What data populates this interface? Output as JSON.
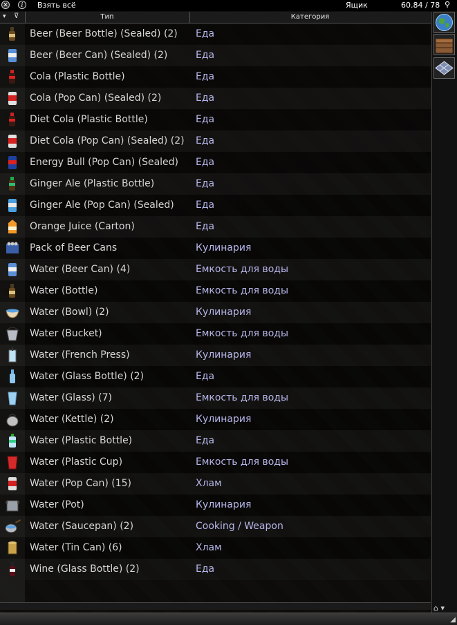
{
  "titlebar": {
    "take_all": "Взять всё",
    "container": "Ящик",
    "weight": "60.84 / 78",
    "info": "i",
    "close": "✕",
    "pin": "⚲"
  },
  "columns": {
    "type": "Тип",
    "category": "Категория",
    "sort": "▾",
    "filter": "⊽"
  },
  "rows": [
    {
      "name": "Beer (Beer Bottle) (Sealed) (2)",
      "category": "Еда",
      "icon": "beer-bottle-icon"
    },
    {
      "name": "Beer (Beer Can) (Sealed) (2)",
      "category": "Еда",
      "icon": "beer-can-icon"
    },
    {
      "name": "Cola (Plastic Bottle)",
      "category": "Еда",
      "icon": "cola-bottle-icon"
    },
    {
      "name": "Cola (Pop Can) (Sealed) (2)",
      "category": "Еда",
      "icon": "pop-can-icon"
    },
    {
      "name": "Diet Cola (Plastic Bottle)",
      "category": "Еда",
      "icon": "cola-bottle-icon"
    },
    {
      "name": "Diet Cola (Pop Can) (Sealed) (2)",
      "category": "Еда",
      "icon": "pop-can-icon"
    },
    {
      "name": "Energy Bull (Pop Can) (Sealed)",
      "category": "Еда",
      "icon": "energy-can-icon"
    },
    {
      "name": "Ginger Ale (Plastic Bottle)",
      "category": "Еда",
      "icon": "ginger-bottle-icon"
    },
    {
      "name": "Ginger Ale (Pop Can) (Sealed)",
      "category": "Еда",
      "icon": "ginger-can-icon"
    },
    {
      "name": "Orange Juice (Carton)",
      "category": "Еда",
      "icon": "juice-carton-icon"
    },
    {
      "name": "Pack of Beer Cans",
      "category": "Кулинария",
      "icon": "beer-pack-icon"
    },
    {
      "name": "Water (Beer Can) (4)",
      "category": "Емкость для воды",
      "icon": "beer-can-icon"
    },
    {
      "name": "Water (Bottle)",
      "category": "Емкость для воды",
      "icon": "beer-bottle-icon"
    },
    {
      "name": "Water (Bowl) (2)",
      "category": "Кулинария",
      "icon": "bowl-icon"
    },
    {
      "name": "Water (Bucket)",
      "category": "Емкость для воды",
      "icon": "bucket-icon"
    },
    {
      "name": "Water (French Press)",
      "category": "Кулинария",
      "icon": "french-press-icon"
    },
    {
      "name": "Water (Glass Bottle) (2)",
      "category": "Еда",
      "icon": "glass-bottle-icon"
    },
    {
      "name": "Water (Glass) (7)",
      "category": "Емкость для воды",
      "icon": "glass-icon"
    },
    {
      "name": "Water (Kettle) (2)",
      "category": "Кулинария",
      "icon": "kettle-icon"
    },
    {
      "name": "Water (Plastic Bottle)",
      "category": "Еда",
      "icon": "water-bottle-icon"
    },
    {
      "name": "Water (Plastic Cup)",
      "category": "Емкость для воды",
      "icon": "plastic-cup-icon"
    },
    {
      "name": "Water (Pop Can) (15)",
      "category": "Хлам",
      "icon": "pop-can-icon"
    },
    {
      "name": "Water (Pot)",
      "category": "Кулинария",
      "icon": "pot-icon"
    },
    {
      "name": "Water (Saucepan) (2)",
      "category": "Cooking / Weapon",
      "icon": "saucepan-icon"
    },
    {
      "name": "Water (Tin Can) (6)",
      "category": "Хлам",
      "icon": "tin-can-icon"
    },
    {
      "name": "Wine (Glass Bottle) (2)",
      "category": "Еда",
      "icon": "wine-bottle-icon"
    }
  ],
  "sidepanel": {
    "earth": "earth-icon",
    "crate": "crate-icon",
    "floor": "floor-icon",
    "bottom": "⌂ ▾"
  },
  "colors": {
    "category_text": "#b6b6ea",
    "item_text": "#d6d6d6"
  }
}
